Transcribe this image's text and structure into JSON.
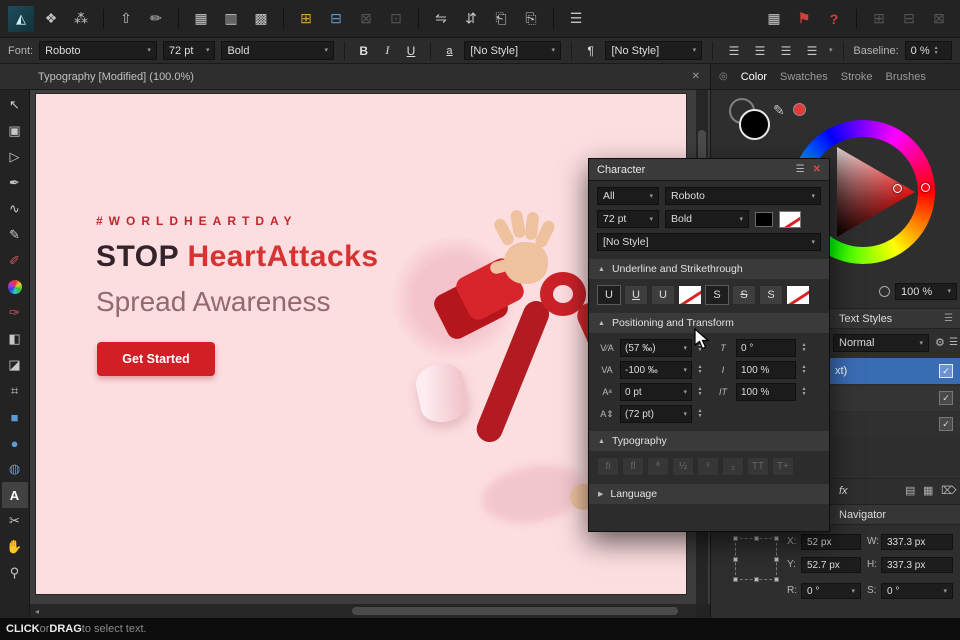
{
  "colors": {
    "accent_red": "#d21f26",
    "poster_bg": "#fcdde0",
    "selection_blue": "#3a6cb4"
  },
  "icons": {
    "dropdown": "▾",
    "menu": "☰",
    "close": "✕",
    "check": "✓",
    "gear": "⚙",
    "pilcrow": "¶",
    "spin_up": "▲",
    "spin_down": "▼",
    "circle": "○",
    "page": "▤",
    "grid": "▦",
    "trash": "⌦",
    "scroll_left": "◂",
    "scroll_right": "▸",
    "collapse": "▲",
    "expand": "▶",
    "eyedropper": "✎",
    "cycle": "◎"
  },
  "top_toolbar": {
    "groups": [
      [
        {
          "name": "affinity-designer-logo",
          "glyph": "◭",
          "cls": "logo"
        },
        {
          "name": "pixel-persona-icon",
          "glyph": "❖"
        },
        {
          "name": "export-persona-icon",
          "glyph": "⁂"
        }
      ],
      [
        {
          "name": "place-content-icon",
          "glyph": "⇧"
        },
        {
          "name": "fill-tool-icon",
          "glyph": "✏"
        }
      ],
      [
        {
          "name": "show-grid-icon",
          "glyph": "▦"
        },
        {
          "name": "show-guides-icon",
          "glyph": "▥"
        },
        {
          "name": "manage-grids-icon",
          "glyph": "▩"
        }
      ],
      [
        {
          "name": "snap-toggle-icon",
          "glyph": "⊞",
          "cls": "amber"
        },
        {
          "name": "snap-candidates-icon",
          "glyph": "⊟",
          "cls": "blue"
        },
        {
          "name": "snap-grid-icon",
          "glyph": "⊠",
          "cls": "dim"
        },
        {
          "name": "snap-pixel-icon",
          "glyph": "⊡",
          "cls": "dim"
        }
      ],
      [
        {
          "name": "flip-horizontal-icon",
          "glyph": "⇋"
        },
        {
          "name": "flip-vertical-icon",
          "glyph": "⇵"
        },
        {
          "name": "rotate-ccw-icon",
          "glyph": "⎗"
        },
        {
          "name": "rotate-cw-icon",
          "glyph": "⎘"
        }
      ],
      [
        {
          "name": "arrange-order-icon",
          "glyph": "☰"
        }
      ],
      [
        {
          "name": "divider-grid-icon",
          "glyph": "▦"
        },
        {
          "name": "color-flag-icon",
          "glyph": "⚑",
          "cls": "red"
        },
        {
          "name": "help-icon",
          "glyph": "?",
          "cls": "red"
        }
      ],
      [
        {
          "name": "insert-behind-icon",
          "glyph": "⊞",
          "cls": "dim"
        },
        {
          "name": "insert-on-top-icon",
          "glyph": "⊟",
          "cls": "dim"
        },
        {
          "name": "insert-inside-icon",
          "glyph": "⊠",
          "cls": "dim"
        }
      ]
    ]
  },
  "font_bar": {
    "font_label": "Font:",
    "font_family": "Roboto",
    "font_size": "72 pt",
    "font_weight": "Bold",
    "bold_label": "B",
    "italic_label": "I",
    "underline_label": "U",
    "underline_style_label": "a",
    "char_style": "[No Style]",
    "para_style": "[No Style]",
    "align_buttons": [
      {
        "name": "align-left-button",
        "glyph": "☰"
      },
      {
        "name": "align-center-button",
        "glyph": "☰"
      },
      {
        "name": "align-right-button",
        "glyph": "☰"
      },
      {
        "name": "align-justify-button",
        "glyph": "☰"
      }
    ],
    "baseline_label": "Baseline:",
    "baseline_value": "0 %"
  },
  "doc_tab": {
    "title": "Typography [Modified] (100.0%)"
  },
  "left_tools": {
    "items": [
      {
        "name": "move-tool",
        "glyph": "↖"
      },
      {
        "name": "frame-text-tool",
        "glyph": "▣"
      },
      {
        "name": "node-tool",
        "glyph": "▷"
      },
      {
        "name": "pen-tool",
        "glyph": "✒"
      },
      {
        "name": "curve-tool",
        "glyph": "∿"
      },
      {
        "name": "pencil-tool",
        "glyph": "✎"
      },
      {
        "name": "brush-tool",
        "glyph": "✐",
        "cls": "redtip"
      },
      {
        "name": "color-wheel-tool",
        "glyph": "",
        "cls": "ball"
      },
      {
        "name": "eyedropper-tool",
        "glyph": "✑",
        "cls": "redtip"
      },
      {
        "name": "gradient-tool",
        "glyph": "◧"
      },
      {
        "name": "transparency-tool",
        "glyph": "◪"
      },
      {
        "name": "crop-tool",
        "glyph": "⌗"
      },
      {
        "name": "rectangle-tool",
        "glyph": "■",
        "cls": "blue"
      },
      {
        "name": "ellipse-tool",
        "glyph": "●",
        "cls": "blue"
      },
      {
        "name": "shape-tool",
        "glyph": "◍",
        "cls": "blue"
      },
      {
        "name": "text-tool",
        "glyph": "A",
        "cls": "active"
      },
      {
        "name": "knife-tool",
        "glyph": "✂"
      },
      {
        "name": "hand-tool",
        "glyph": "✋"
      },
      {
        "name": "zoom-tool",
        "glyph": "⚲"
      }
    ]
  },
  "poster": {
    "hashtag": "#WORLDHEARTDAY",
    "headline_dark": "STOP",
    "headline_red": " HeartAttacks",
    "subheadline": "Spread Awareness",
    "cta_label": "Get Started"
  },
  "character_panel": {
    "title": "Character",
    "collection": "All",
    "font_family": "Roboto",
    "font_size": "72 pt",
    "font_weight": "Bold",
    "text_style": "[No Style]",
    "section_underline": "Underline and Strikethrough",
    "section_positioning": "Positioning and Transform",
    "section_typography": "Typography",
    "section_language": "Language",
    "underline_buttons": [
      {
        "name": "underline-single-button",
        "glyph": "U",
        "cls": "pressed"
      },
      {
        "name": "underline-alt-button",
        "glyph": "U",
        "cls": "u2"
      },
      {
        "name": "underline-heavy-button",
        "glyph": "U"
      },
      {
        "name": "underline-color-swatch",
        "cls": "swatch"
      },
      {
        "name": "strikethrough-single-button",
        "glyph": "S",
        "cls": "pressed"
      },
      {
        "name": "strikethrough-alt-button",
        "glyph": "S",
        "cls": "s2"
      },
      {
        "name": "strikethrough-heavy-button",
        "glyph": "S"
      },
      {
        "name": "strikethrough-color-swatch",
        "cls": "swatch"
      }
    ],
    "fields_left": [
      {
        "name": "kerning-field",
        "icon": "V⁄A",
        "value": "(57 ‰)"
      },
      {
        "name": "tracking-field",
        "icon": "VA",
        "value": "-100 ‰"
      },
      {
        "name": "baseline-shift-field",
        "icon": "Aᵃ",
        "value": "0 pt"
      },
      {
        "name": "leading-override-field",
        "icon": "A⇕",
        "value": "(72 pt)"
      }
    ],
    "fields_right": [
      {
        "name": "shear-field",
        "icon": "T",
        "value": "0 °"
      },
      {
        "name": "horizontal-scale-field",
        "icon": "I",
        "value": "100 %"
      },
      {
        "name": "vertical-scale-field",
        "icon": "IT",
        "value": "100 %"
      }
    ],
    "typography_buttons": [
      "fi",
      "ﬂ",
      "ª",
      "½",
      "ˢ",
      "₂",
      "TT",
      "T+"
    ]
  },
  "right_panel": {
    "tabs": [
      {
        "name": "tab-color",
        "label": "Color",
        "cls": "active"
      },
      {
        "name": "tab-swatches",
        "label": "Swatches"
      },
      {
        "name": "tab-stroke",
        "label": "Stroke"
      },
      {
        "name": "tab-brushes",
        "label": "Brushes"
      }
    ],
    "opacity_value": "100 %",
    "text_styles_header": "Text Styles",
    "style_selector": "Normal",
    "layer_partial_label": "xt)",
    "fx_label": "fx",
    "navigator_header": "Navigator",
    "transform": {
      "x_label": "X:",
      "x_value": "52 px",
      "y_label": "Y:",
      "y_value": "52.7 px",
      "w_label": "W:",
      "w_value": "337.3 px",
      "h_label": "H:",
      "h_value": "337.3 px",
      "r_label": "R:",
      "r_value": "0 °",
      "s_label": "S:",
      "s_value": "0 °"
    }
  },
  "status_bar": {
    "click": "CLICK",
    "or": " or ",
    "drag": "DRAG",
    "rest": " to select text."
  }
}
